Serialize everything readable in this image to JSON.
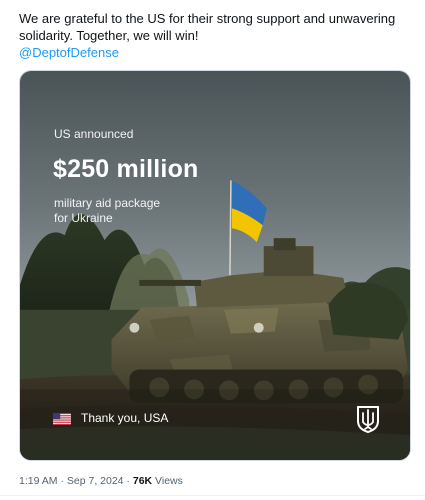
{
  "post": {
    "text_line1": "We are grateful to the US for their strong support and unwavering",
    "text_line2": "solidarity. Together, we will win!",
    "mention": "@DeptofDefense"
  },
  "media": {
    "announced": "US announced",
    "amount": "$250 million",
    "description_line1": "military aid package",
    "description_line2": "for Ukraine",
    "thanks": "Thank you, USA",
    "icons": [
      "us-flag-icon",
      "ukraine-flag",
      "armed-forces-emblem-icon"
    ]
  },
  "meta": {
    "time": "1:19 AM",
    "sep1": " · ",
    "date": "Sep 7, 2024",
    "sep2": " · ",
    "views_count": "76K",
    "views_label": " Views"
  },
  "colors": {
    "link": "#1d9bf0",
    "text": "#0f1419",
    "secondary": "#536471",
    "ukraine_blue": "#2f6fb8",
    "ukraine_yellow": "#f2c500"
  }
}
